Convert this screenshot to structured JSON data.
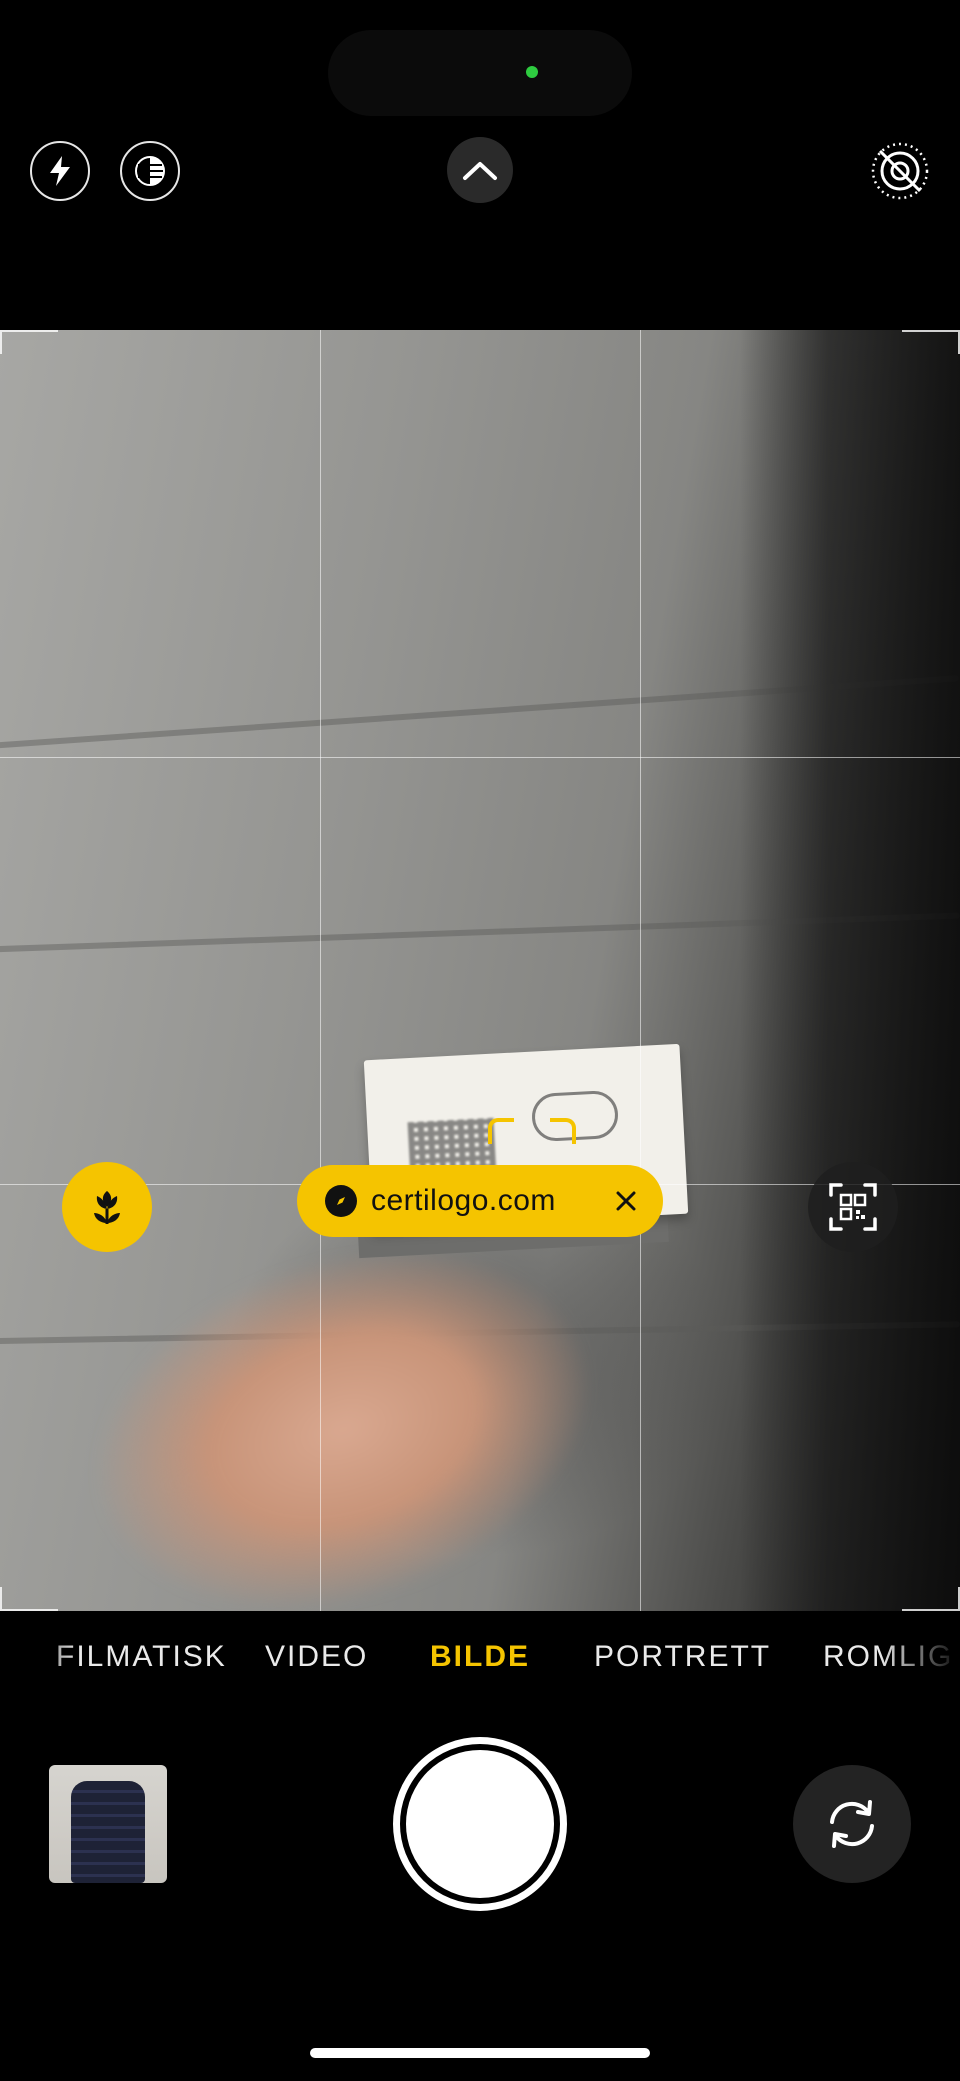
{
  "top_bar": {
    "flash_icon": "bolt-icon",
    "live_icon": "live-photo-icon",
    "controls_icon": "chevron-up-icon",
    "live_off_icon": "live-photo-off-icon",
    "camera_indicator_color": "#2ecc40"
  },
  "viewfinder": {
    "grid": "3x3",
    "focus_color": "#f5c400",
    "macro_icon": "flower-macro-icon",
    "qr_scan_icon": "qr-scan-icon",
    "detected_link": {
      "text": "certilogo.com",
      "icon": "safari-compass-icon",
      "close_icon": "close-icon"
    }
  },
  "modes": {
    "items": [
      "FILMATISK",
      "VIDEO",
      "BILDE",
      "PORTRETT",
      "ROMLIG"
    ],
    "active": "BILDE",
    "active_color": "#f5c400"
  },
  "bottom": {
    "thumbnail_icon": "photo-thumbnail",
    "shutter_icon": "shutter-button",
    "flip_icon": "camera-flip-icon"
  }
}
